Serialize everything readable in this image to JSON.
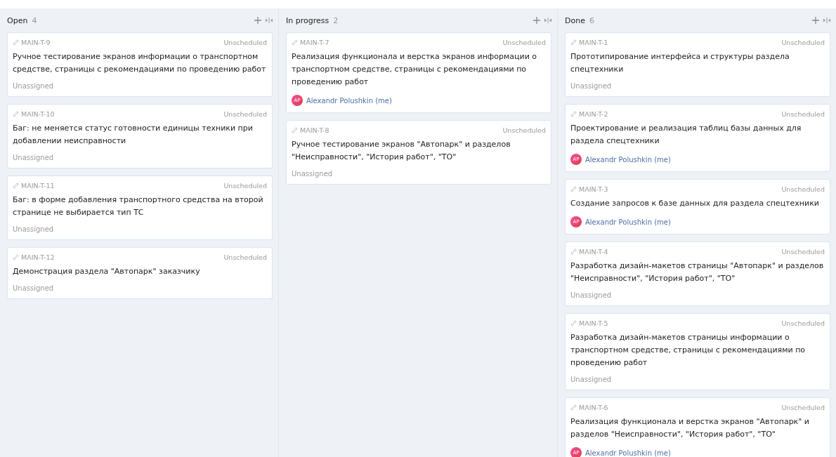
{
  "columns": [
    {
      "title": "Open",
      "count": "4",
      "cards": [
        {
          "key": "MAIN-T-9",
          "schedule": "Unscheduled",
          "title": "Ручное тестирование экранов информации о транспортном средстве, страницы с рекомендациями по проведению работ",
          "assignee": {
            "kind": "none",
            "name": "Unassigned"
          }
        },
        {
          "key": "MAIN-T-10",
          "schedule": "Unscheduled",
          "title": "Баг: не меняется статус готовности единицы техники при добавлении неисправности",
          "assignee": {
            "kind": "none",
            "name": "Unassigned"
          }
        },
        {
          "key": "MAIN-T-11",
          "schedule": "Unscheduled",
          "title": "Баг: в форме добавления транспортного средства на второй странице не выбирается тип ТС",
          "assignee": {
            "kind": "none",
            "name": "Unassigned"
          }
        },
        {
          "key": "MAIN-T-12",
          "schedule": "Unscheduled",
          "title": "Демонстрация раздела \"Автопарк\" заказчику",
          "assignee": {
            "kind": "none",
            "name": "Unassigned"
          }
        }
      ]
    },
    {
      "title": "In progress",
      "count": "2",
      "cards": [
        {
          "key": "MAIN-T-7",
          "schedule": "Unscheduled",
          "title": "Реализация функционала и верстка экранов информации о транспортном средстве, страницы с рекомендациями по проведению работ",
          "assignee": {
            "kind": "user",
            "initials": "AP",
            "name": "Alexandr Polushkin (me)"
          }
        },
        {
          "key": "MAIN-T-8",
          "schedule": "Unscheduled",
          "title": "Ручное тестирование экранов \"Автопарк\" и разделов \"Неисправности\", \"История работ\", \"ТО\"",
          "assignee": {
            "kind": "none",
            "name": "Unassigned"
          }
        }
      ]
    },
    {
      "title": "Done",
      "count": "6",
      "cards": [
        {
          "key": "MAIN-T-1",
          "schedule": "Unscheduled",
          "title": "Прототипирование интерфейса и структуры раздела спецтехники",
          "assignee": {
            "kind": "none",
            "name": "Unassigned"
          }
        },
        {
          "key": "MAIN-T-2",
          "schedule": "Unscheduled",
          "title": "Проектирование и реализация таблиц базы данных для раздела спецтехники",
          "assignee": {
            "kind": "user",
            "initials": "AP",
            "name": "Alexandr Polushkin (me)"
          }
        },
        {
          "key": "MAIN-T-3",
          "schedule": "Unscheduled",
          "title": "Создание запросов к базе данных для раздела спецтехники",
          "assignee": {
            "kind": "user",
            "initials": "AP",
            "name": "Alexandr Polushkin (me)"
          }
        },
        {
          "key": "MAIN-T-4",
          "schedule": "Unscheduled",
          "title": "Разработка дизайн-макетов страницы \"Автопарк\" и разделов \"Неисправности\", \"История работ\", \"ТО\"",
          "assignee": {
            "kind": "none",
            "name": "Unassigned"
          }
        },
        {
          "key": "MAIN-T-5",
          "schedule": "Unscheduled",
          "title": "Разработка дизайн-макетов страницы информации о транспортном средстве, страницы с рекомендациями по проведению работ",
          "assignee": {
            "kind": "none",
            "name": "Unassigned"
          }
        },
        {
          "key": "MAIN-T-6",
          "schedule": "Unscheduled",
          "title": "Реализация функционала и верстка экранов \"Автопарк\" и разделов \"Неисправности\", \"История работ\", \"ТО\"",
          "assignee": {
            "kind": "user",
            "initials": "AP",
            "name": "Alexandr Polushkin (me)"
          }
        }
      ]
    }
  ]
}
